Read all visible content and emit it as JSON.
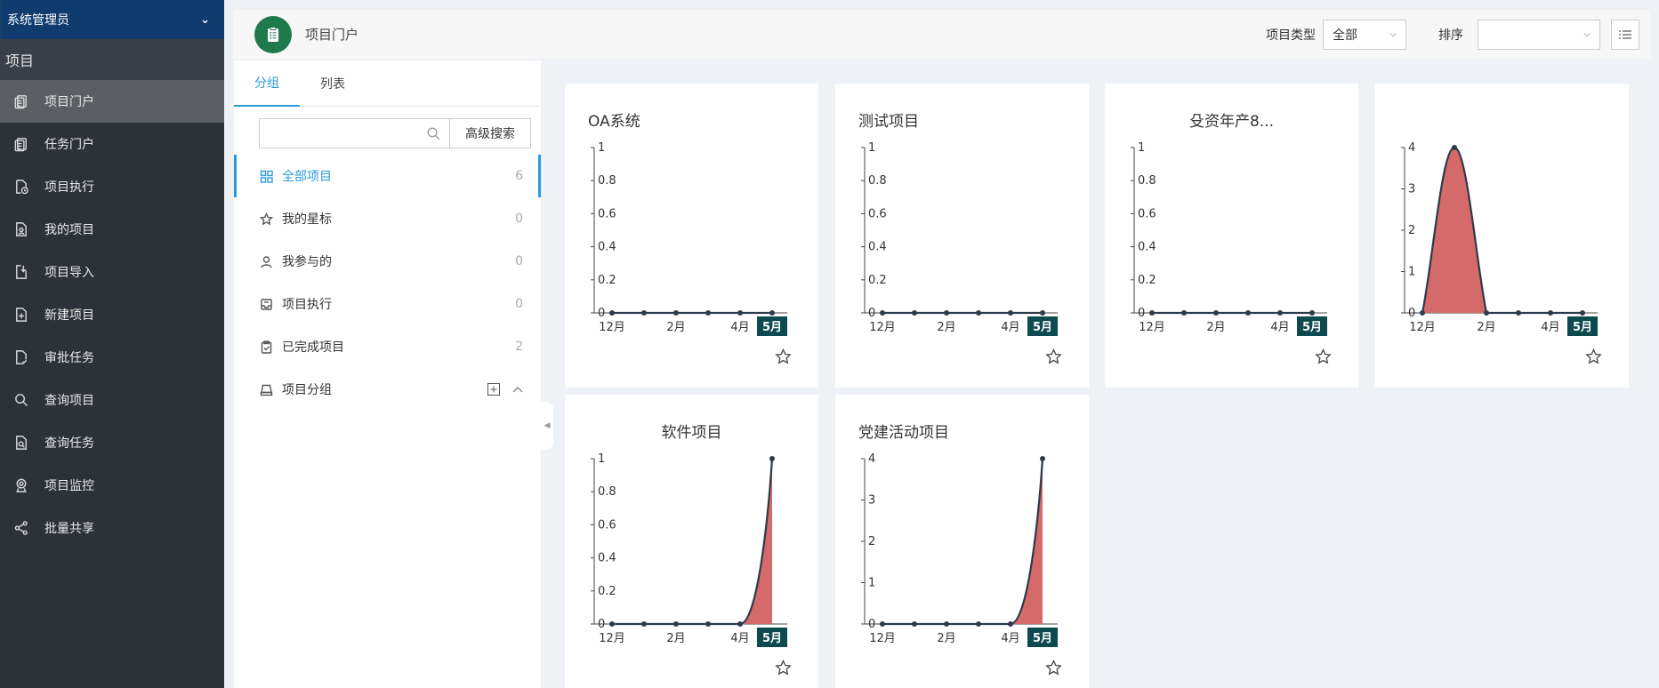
{
  "sidebar": {
    "user": "系统管理员",
    "section": "项目",
    "items": [
      {
        "label": "项目门户",
        "icon": "document-icon",
        "active": true
      },
      {
        "label": "任务门户",
        "icon": "document-icon"
      },
      {
        "label": "项目执行",
        "icon": "file-clock-icon"
      },
      {
        "label": "我的项目",
        "icon": "file-user-icon"
      },
      {
        "label": "项目导入",
        "icon": "file-import-icon"
      },
      {
        "label": "新建项目",
        "icon": "file-plus-icon"
      },
      {
        "label": "审批任务",
        "icon": "file-check-icon"
      },
      {
        "label": "查询项目",
        "icon": "search-icon"
      },
      {
        "label": "查询任务",
        "icon": "file-search-icon"
      },
      {
        "label": "项目监控",
        "icon": "webcam-icon"
      },
      {
        "label": "批量共享",
        "icon": "share-icon"
      }
    ]
  },
  "header": {
    "title": "项目门户",
    "type_label": "项目类型",
    "type_value": "全部",
    "sort_label": "排序",
    "sort_value": ""
  },
  "panel": {
    "tabs": [
      {
        "label": "分组",
        "active": true
      },
      {
        "label": "列表"
      }
    ],
    "search_placeholder": "",
    "adv_search": "高级搜索",
    "items": [
      {
        "label": "全部项目",
        "count": "6",
        "icon": "grid-icon",
        "active": true
      },
      {
        "label": "我的星标",
        "count": "0",
        "icon": "star-icon"
      },
      {
        "label": "我参与的",
        "count": "0",
        "icon": "user-icon"
      },
      {
        "label": "项目执行",
        "count": "0",
        "icon": "inbox-icon"
      },
      {
        "label": "已完成项目",
        "count": "2",
        "icon": "clipboard-check-icon"
      },
      {
        "label": "项目分组",
        "count": "",
        "icon": "tray-icon"
      }
    ]
  },
  "colors": {
    "accent": "#2a9bd8",
    "area": "#d46a6a",
    "highlight_tab": "#0d4a50"
  },
  "chart_data": [
    {
      "type": "area",
      "title": "OA系统",
      "title_align": "left",
      "x": [
        "12月",
        "",
        "2月",
        "",
        "4月",
        "5月"
      ],
      "y": [
        0,
        0,
        0,
        0,
        0,
        0
      ],
      "yticks": [
        "0",
        "0.2",
        "0.4",
        "0.6",
        "0.8",
        "1"
      ],
      "ymax": 1
    },
    {
      "type": "area",
      "title": "测试项目",
      "title_align": "left",
      "x": [
        "12月",
        "",
        "2月",
        "",
        "4月",
        "5月"
      ],
      "y": [
        0,
        0,
        0,
        0,
        0,
        0
      ],
      "yticks": [
        "0",
        "0.2",
        "0.4",
        "0.6",
        "0.8",
        "1"
      ],
      "ymax": 1
    },
    {
      "type": "area",
      "title": "殳资年产8...",
      "title_align": "center",
      "x": [
        "12月",
        "",
        "2月",
        "",
        "4月",
        "5月"
      ],
      "y": [
        0,
        0,
        0,
        0,
        0,
        0
      ],
      "yticks": [
        "0",
        "0.2",
        "0.4",
        "0.6",
        "0.8",
        "1"
      ],
      "ymax": 1
    },
    {
      "type": "area",
      "title": "",
      "title_align": "center",
      "x": [
        "12月",
        "",
        "2月",
        "",
        "4月",
        "5月"
      ],
      "y": [
        0,
        4,
        0,
        0,
        0,
        0
      ],
      "yticks": [
        "0",
        "1",
        "2",
        "3",
        "4"
      ],
      "ymax": 4
    },
    {
      "type": "area",
      "title": "软件项目",
      "title_align": "center",
      "x": [
        "12月",
        "",
        "2月",
        "",
        "4月",
        "5月"
      ],
      "y": [
        0,
        0,
        0,
        0,
        0,
        1
      ],
      "yticks": [
        "0",
        "0.2",
        "0.4",
        "0.6",
        "0.8",
        "1"
      ],
      "ymax": 1
    },
    {
      "type": "area",
      "title": "党建活动项目",
      "title_align": "left",
      "x": [
        "12月",
        "",
        "2月",
        "",
        "4月",
        "5月"
      ],
      "y": [
        0,
        0,
        0,
        0,
        0,
        4
      ],
      "yticks": [
        "0",
        "1",
        "2",
        "3",
        "4"
      ],
      "ymax": 4
    }
  ]
}
